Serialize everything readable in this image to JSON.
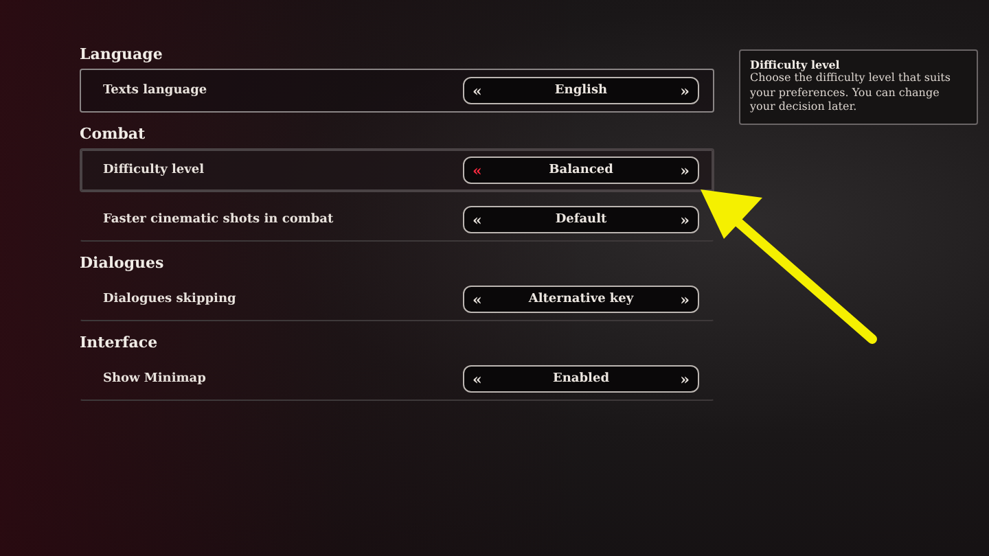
{
  "sections": [
    {
      "title": "Language",
      "rows": [
        {
          "label": "Texts language",
          "value": "English",
          "prev": "«",
          "next": "»",
          "selected": true,
          "hovered": false,
          "prev_active": false
        }
      ]
    },
    {
      "title": "Combat",
      "rows": [
        {
          "label": "Difficulty level",
          "value": "Balanced",
          "prev": "«",
          "next": "»",
          "selected": false,
          "hovered": true,
          "prev_active": true
        },
        {
          "label": "Faster cinematic shots in combat",
          "value": "Default",
          "prev": "«",
          "next": "»",
          "selected": false,
          "hovered": false,
          "prev_active": false
        }
      ]
    },
    {
      "title": "Dialogues",
      "rows": [
        {
          "label": "Dialogues skipping",
          "value": "Alternative key",
          "prev": "«",
          "next": "»",
          "selected": false,
          "hovered": false,
          "prev_active": false
        }
      ]
    },
    {
      "title": "Interface",
      "rows": [
        {
          "label": "Show Minimap",
          "value": "Enabled",
          "prev": "«",
          "next": "»",
          "selected": false,
          "hovered": false,
          "prev_active": false
        }
      ]
    }
  ],
  "tooltip": {
    "title": "Difficulty level",
    "text": "Choose the difficulty level that suits your preferences. You can change your decision later."
  }
}
